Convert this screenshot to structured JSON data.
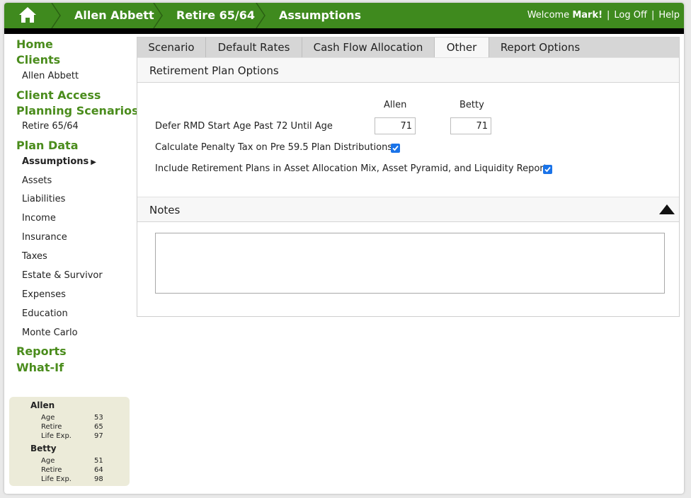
{
  "breadcrumb": [
    "Allen Abbett",
    "Retire 65/64",
    "Assumptions"
  ],
  "header": {
    "welcome_prefix": "Welcome",
    "user_name": "Mark!",
    "logoff_label": "Log Off",
    "help_label": "Help"
  },
  "sidebar": {
    "home": "Home",
    "clients": "Clients",
    "client_name": "Allen Abbett",
    "client_access": "Client Access",
    "planning_scenarios": "Planning Scenarios",
    "scenario_name": "Retire 65/64",
    "plan_data": "Plan Data",
    "plan_items": [
      "Assumptions",
      "Assets",
      "Liabilities",
      "Income",
      "Insurance",
      "Taxes",
      "Estate & Survivor",
      "Expenses",
      "Education",
      "Monte Carlo"
    ],
    "active_item_arrow": "▶",
    "reports": "Reports",
    "what_if": "What-If"
  },
  "summary": {
    "people": [
      {
        "name": "Allen",
        "rows": [
          {
            "label": "Age",
            "value": "53"
          },
          {
            "label": "Retire",
            "value": "65"
          },
          {
            "label": "Life Exp.",
            "value": "97"
          }
        ]
      },
      {
        "name": "Betty",
        "rows": [
          {
            "label": "Age",
            "value": "51"
          },
          {
            "label": "Retire",
            "value": "64"
          },
          {
            "label": "Life Exp.",
            "value": "98"
          }
        ]
      }
    ]
  },
  "tabs": [
    "Scenario",
    "Default Rates",
    "Cash Flow Allocation",
    "Other",
    "Report Options"
  ],
  "active_tab": "Other",
  "retirement": {
    "title": "Retirement Plan Options",
    "col1": "Allen",
    "col2": "Betty",
    "rmd_label": "Defer RMD Start Age Past 72 Until Age",
    "rmd_allen": "71",
    "rmd_betty": "71",
    "penalty_label": "Calculate Penalty Tax on Pre 59.5 Plan Distributions",
    "penalty_checked": true,
    "include_label": "Include Retirement Plans in Asset Allocation Mix, Asset Pyramid, and Liquidity Reports",
    "include_checked": true
  },
  "notes": {
    "title": "Notes",
    "value": ""
  },
  "colors": {
    "brand_green": "#3f8a1e",
    "nav_green": "#4a8c1c",
    "checkbox_blue": "#1a73e8",
    "summary_bg": "#ecebd9"
  }
}
